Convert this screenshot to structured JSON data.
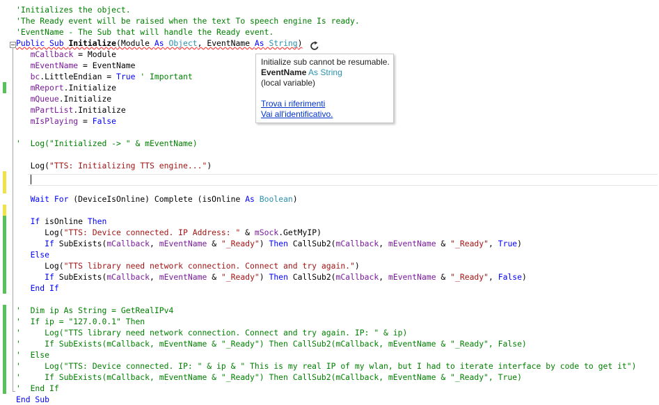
{
  "editor": {
    "lines": [
      {
        "tokens": [
          {
            "t": "'Initializes the object.",
            "c": "cm"
          }
        ]
      },
      {
        "tokens": [
          {
            "t": "'The Ready event will be raised when the text To speech engine Is ready.",
            "c": "cm"
          }
        ]
      },
      {
        "tokens": [
          {
            "t": "'EventName - The Sub that will handle the Ready event.",
            "c": "cm"
          }
        ]
      },
      {
        "tokens": [
          {
            "t": "Public Sub ",
            "c": "kw sq"
          },
          {
            "t": "Initialize",
            "c": "bold sq"
          },
          {
            "t": "(Module ",
            "c": "sq"
          },
          {
            "t": "As",
            "c": "kw sq"
          },
          {
            "t": " ",
            "c": "sq"
          },
          {
            "t": "Object",
            "c": "tp sq"
          },
          {
            "t": ", EventName ",
            "c": "sq"
          },
          {
            "t": "As",
            "c": "kw sq"
          },
          {
            "t": " ",
            "c": "sq"
          },
          {
            "t": "String",
            "c": "tp sq"
          },
          {
            "t": ")",
            "c": "sq"
          }
        ]
      },
      {
        "tokens": [
          {
            "t": "   "
          },
          {
            "t": "mCallback",
            "c": "var"
          },
          {
            "t": " = Module"
          }
        ]
      },
      {
        "tokens": [
          {
            "t": "   "
          },
          {
            "t": "mEventName",
            "c": "var"
          },
          {
            "t": " = EventName"
          }
        ]
      },
      {
        "tokens": [
          {
            "t": "   "
          },
          {
            "t": "bc",
            "c": "var"
          },
          {
            "t": ".LittleEndian = "
          },
          {
            "t": "True",
            "c": "kw"
          },
          {
            "t": " ' Important",
            "c": "cm"
          }
        ]
      },
      {
        "tokens": [
          {
            "t": "   "
          },
          {
            "t": "mReport",
            "c": "var"
          },
          {
            "t": ".Initialize"
          }
        ]
      },
      {
        "tokens": [
          {
            "t": "   "
          },
          {
            "t": "mQueue",
            "c": "var"
          },
          {
            "t": ".Initialize"
          }
        ]
      },
      {
        "tokens": [
          {
            "t": "   "
          },
          {
            "t": "mPartList",
            "c": "var"
          },
          {
            "t": ".Initialize"
          }
        ]
      },
      {
        "tokens": [
          {
            "t": "   "
          },
          {
            "t": "mIsPlaying",
            "c": "var"
          },
          {
            "t": " = "
          },
          {
            "t": "False",
            "c": "kw"
          }
        ]
      },
      {
        "tokens": []
      },
      {
        "tokens": [
          {
            "t": "'  Log(\"Initialized -> \" & mEventName)",
            "c": "cm"
          }
        ]
      },
      {
        "tokens": []
      },
      {
        "tokens": [
          {
            "t": "   Log("
          },
          {
            "t": "\"TTS: Initializing TTS engine...\"",
            "c": "str"
          },
          {
            "t": ")"
          }
        ]
      },
      {
        "tokens": []
      },
      {
        "tokens": []
      },
      {
        "tokens": [
          {
            "t": "   "
          },
          {
            "t": "Wait For",
            "c": "kw"
          },
          {
            "t": " (DeviceIsOnline) Complete (isOnline "
          },
          {
            "t": "As",
            "c": "kw"
          },
          {
            "t": " "
          },
          {
            "t": "Boolean",
            "c": "tp"
          },
          {
            "t": ")"
          }
        ]
      },
      {
        "tokens": []
      },
      {
        "tokens": [
          {
            "t": "   "
          },
          {
            "t": "If",
            "c": "kw"
          },
          {
            "t": " isOnline "
          },
          {
            "t": "Then",
            "c": "kw"
          }
        ]
      },
      {
        "tokens": [
          {
            "t": "      Log("
          },
          {
            "t": "\"TTS: Device connected. IP Address: \"",
            "c": "str"
          },
          {
            "t": " & "
          },
          {
            "t": "mSock",
            "c": "var"
          },
          {
            "t": ".GetMyIP)"
          }
        ]
      },
      {
        "tokens": [
          {
            "t": "      "
          },
          {
            "t": "If",
            "c": "kw"
          },
          {
            "t": " SubExists("
          },
          {
            "t": "mCallback",
            "c": "var"
          },
          {
            "t": ", "
          },
          {
            "t": "mEventName",
            "c": "var"
          },
          {
            "t": " & "
          },
          {
            "t": "\"_Ready\"",
            "c": "str"
          },
          {
            "t": ") "
          },
          {
            "t": "Then",
            "c": "kw"
          },
          {
            "t": " CallSub2("
          },
          {
            "t": "mCallback",
            "c": "var"
          },
          {
            "t": ", "
          },
          {
            "t": "mEventName",
            "c": "var"
          },
          {
            "t": " & "
          },
          {
            "t": "\"_Ready\"",
            "c": "str"
          },
          {
            "t": ", "
          },
          {
            "t": "True",
            "c": "kw"
          },
          {
            "t": ")"
          }
        ]
      },
      {
        "tokens": [
          {
            "t": "   "
          },
          {
            "t": "Else",
            "c": "kw"
          }
        ]
      },
      {
        "tokens": [
          {
            "t": "      Log("
          },
          {
            "t": "\"TTS library need network connection. Connect and try again.\"",
            "c": "str"
          },
          {
            "t": ")"
          }
        ]
      },
      {
        "tokens": [
          {
            "t": "      "
          },
          {
            "t": "If",
            "c": "kw"
          },
          {
            "t": " SubExists("
          },
          {
            "t": "mCallback",
            "c": "var"
          },
          {
            "t": ", "
          },
          {
            "t": "mEventName",
            "c": "var"
          },
          {
            "t": " & "
          },
          {
            "t": "\"_Ready\"",
            "c": "str"
          },
          {
            "t": ") "
          },
          {
            "t": "Then",
            "c": "kw"
          },
          {
            "t": " CallSub2("
          },
          {
            "t": "mCallback",
            "c": "var"
          },
          {
            "t": ", "
          },
          {
            "t": "mEventName",
            "c": "var"
          },
          {
            "t": " & "
          },
          {
            "t": "\"_Ready\"",
            "c": "str"
          },
          {
            "t": ", "
          },
          {
            "t": "False",
            "c": "kw"
          },
          {
            "t": ")"
          }
        ]
      },
      {
        "tokens": [
          {
            "t": "   "
          },
          {
            "t": "End If",
            "c": "kw"
          }
        ]
      },
      {
        "tokens": []
      },
      {
        "tokens": [
          {
            "t": "'  Dim ip As String = GetRealIPv4",
            "c": "cm"
          }
        ]
      },
      {
        "tokens": [
          {
            "t": "'  If ip = \"127.0.0.1\" Then",
            "c": "cm"
          }
        ]
      },
      {
        "tokens": [
          {
            "t": "'     Log(\"TTS library need network connection. Connect and try again. IP: \" & ip)",
            "c": "cm"
          }
        ]
      },
      {
        "tokens": [
          {
            "t": "'     If SubExists(mCallback, mEventName & \"_Ready\") Then CallSub2(mCallback, mEventName & \"_Ready\", False)",
            "c": "cm"
          }
        ]
      },
      {
        "tokens": [
          {
            "t": "'  Else",
            "c": "cm"
          }
        ]
      },
      {
        "tokens": [
          {
            "t": "'     Log(\"TTS: Device connected. IP: \" & ip & \" This is my real IP of my wlan, but I had to iterate interface by code to get it\")",
            "c": "cm"
          }
        ]
      },
      {
        "tokens": [
          {
            "t": "'     If SubExists(mCallback, mEventName & \"_Ready\") Then CallSub2(mCallback, mEventName & \"_Ready\", True)",
            "c": "cm"
          }
        ]
      },
      {
        "tokens": [
          {
            "t": "'  End If",
            "c": "cm"
          }
        ]
      },
      {
        "tokens": [
          {
            "t": "End Sub",
            "c": "kw"
          }
        ]
      }
    ],
    "change_marks": [
      {
        "line": 7,
        "count": 1,
        "color": "#57c15a"
      },
      {
        "line": 15,
        "count": 2,
        "color": "#f1e14b"
      },
      {
        "line": 18,
        "count": 1,
        "color": "#f1e14b"
      },
      {
        "line": 19,
        "count": 7,
        "color": "#57c15a"
      },
      {
        "line": 27,
        "count": 8,
        "color": "#57c15a"
      }
    ]
  },
  "tooltip": {
    "line1": "Initialize sub cannot be resumable.",
    "name": "EventName",
    "as_kw": "As",
    "type": "String",
    "scope": "(local variable)",
    "link_refs": "Trova i riferimenti",
    "link_goto": "Vai all'identificativo."
  },
  "icons": {
    "resume": "resumable-sub-icon",
    "fold": "collapse-minus-icon"
  }
}
